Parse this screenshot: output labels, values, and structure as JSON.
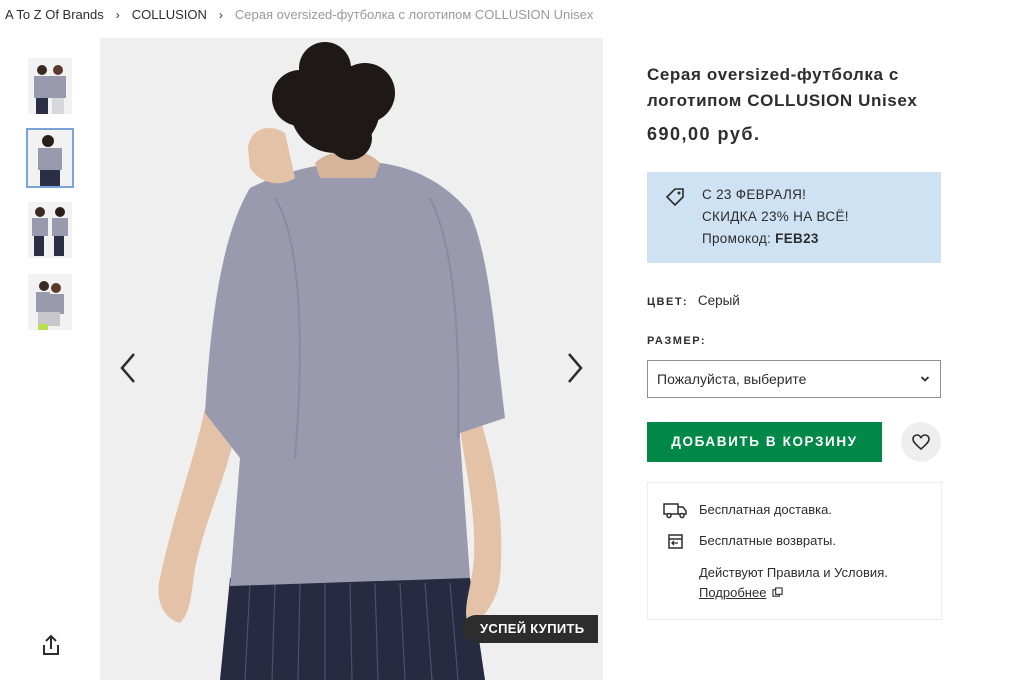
{
  "breadcrumb": {
    "items": [
      "A To Z Of Brands",
      "COLLUSION"
    ],
    "current": "Серая oversized-футболка с логотипом COLLUSION Unisex",
    "separator": "›"
  },
  "product": {
    "title": "Серая oversized-футболка с логотипом COLLUSION Unisex",
    "price": "690,00 руб."
  },
  "image": {
    "badge": "УСПЕЙ КУПИТЬ",
    "shirt_color": "#9a9aae"
  },
  "promo": {
    "line1": "С 23 ФЕВРАЛЯ!",
    "line2": "СКИДКА 23% НА ВСЁ!",
    "code_label": "Промокод:",
    "code_value": "FEB23",
    "background": "#cfe2f4"
  },
  "color": {
    "label": "ЦВЕТ:",
    "value": "Серый"
  },
  "size": {
    "label": "РАЗМЕР:",
    "placeholder": "Пожалуйста, выберите"
  },
  "actions": {
    "add_to_cart": "ДОБАВИТЬ В КОРЗИНУ",
    "add_color": "#018849"
  },
  "delivery": {
    "free_delivery": "Бесплатная доставка.",
    "free_returns": "Бесплатные возвраты.",
    "terms": "Действуют Правила и Условия.",
    "more": "Подробнее"
  },
  "icons": [
    "share-icon",
    "chevron-left-icon",
    "chevron-right-icon",
    "tag-icon",
    "chevron-down-icon",
    "heart-icon",
    "truck-icon",
    "returns-icon",
    "external-link-icon"
  ]
}
